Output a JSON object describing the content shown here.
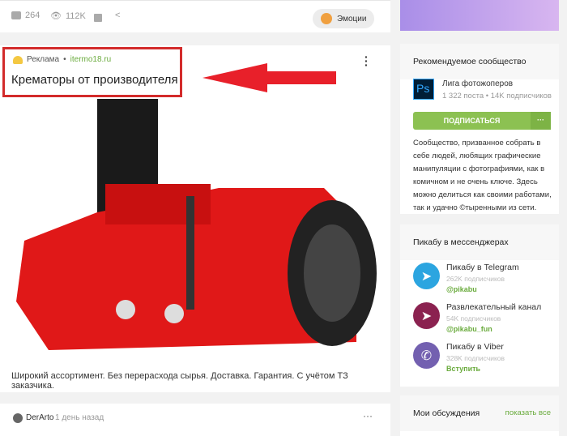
{
  "top_post": {
    "comments": "264",
    "views": "112K",
    "emotions_label": "Эмоции"
  },
  "ad": {
    "label": "Реклама",
    "domain": "itermo18.ru",
    "title": "Крематоры от производителя",
    "description": "Широкий ассортимент. Без перерасхода сырья. Доставка. Гарантия. С учётом ТЗ заказчика."
  },
  "next_post": {
    "author": "DerArto",
    "time": "1 день назад"
  },
  "community": {
    "header": "Рекомендуемое сообщество",
    "logo_text": "Ps",
    "name": "Лига фотожоперов",
    "posts": "1 322 поста",
    "subscribers": "14K подписчиков",
    "subscribe_label": "ПОДПИСАТЬСЯ",
    "more_label": "···",
    "description": "Сообщество, призванное собрать в себе людей, любящих графические манипуляции с фотографиями, как в комичном и не очень ключе. Здесь можно делиться как своими работами, так и удачно ©тыренными из сети."
  },
  "messengers": {
    "header": "Пикабу в мессенджерах",
    "items": [
      {
        "title": "Пикабу в Telegram",
        "subs": "262K подписчиков",
        "link": "@pikabu",
        "color": "#2ca5e0"
      },
      {
        "title": "Развлекательный канал",
        "subs": "54K подписчиков",
        "link": "@pikabu_fun",
        "color": "#8b2250"
      },
      {
        "title": "Пикабу в Viber",
        "subs": "328K подписчиков",
        "link": "Вступить",
        "color": "#7360b0"
      }
    ]
  },
  "discussions": {
    "header": "Мои обсуждения",
    "show_all": "показать все"
  }
}
